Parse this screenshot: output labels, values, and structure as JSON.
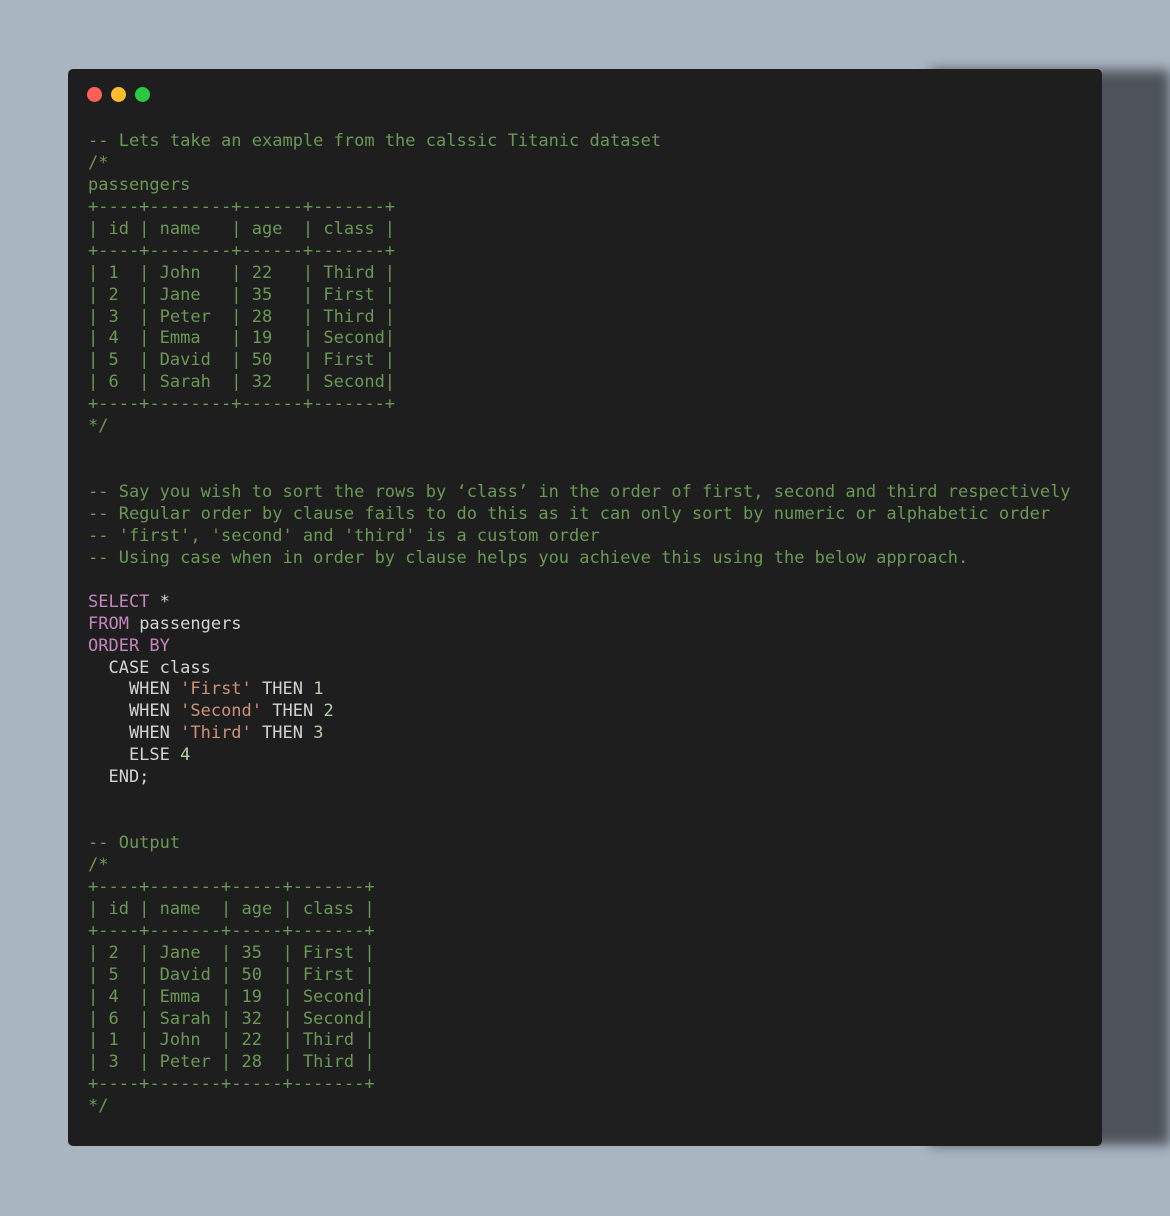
{
  "window": {
    "controls": {
      "close_color": "#ff5f57",
      "minimize_color": "#febc2e",
      "maximize_color": "#28c840"
    }
  },
  "code_lines": [
    [
      {
        "t": "comment",
        "s": "-- Lets take an example from the calssic Titanic dataset"
      }
    ],
    [
      {
        "t": "comment",
        "s": "/*"
      }
    ],
    [
      {
        "t": "comment",
        "s": "passengers"
      }
    ],
    [
      {
        "t": "comment",
        "s": "+----+--------+------+-------+"
      }
    ],
    [
      {
        "t": "comment",
        "s": "| id | name   | age  | class |"
      }
    ],
    [
      {
        "t": "comment",
        "s": "+----+--------+------+-------+"
      }
    ],
    [
      {
        "t": "comment",
        "s": "| 1  | John   | 22   | Third |"
      }
    ],
    [
      {
        "t": "comment",
        "s": "| 2  | Jane   | 35   | First |"
      }
    ],
    [
      {
        "t": "comment",
        "s": "| 3  | Peter  | 28   | Third |"
      }
    ],
    [
      {
        "t": "comment",
        "s": "| 4  | Emma   | 19   | Second|"
      }
    ],
    [
      {
        "t": "comment",
        "s": "| 5  | David  | 50   | First |"
      }
    ],
    [
      {
        "t": "comment",
        "s": "| 6  | Sarah  | 32   | Second|"
      }
    ],
    [
      {
        "t": "comment",
        "s": "+----+--------+------+-------+"
      }
    ],
    [
      {
        "t": "comment",
        "s": "*/"
      }
    ],
    [],
    [],
    [
      {
        "t": "comment",
        "s": "-- Say you wish to sort the rows by ‘class’ in the order of first, second and third respectively"
      }
    ],
    [
      {
        "t": "comment",
        "s": "-- Regular order by clause fails to do this as it can only sort by numeric or alphabetic order"
      }
    ],
    [
      {
        "t": "comment",
        "s": "-- 'first', 'second' and 'third' is a custom order"
      }
    ],
    [
      {
        "t": "comment",
        "s": "-- Using case when in order by clause helps you achieve this using the below approach."
      }
    ],
    [],
    [
      {
        "t": "keyword",
        "s": "SELECT"
      },
      {
        "t": "plain",
        "s": " *"
      }
    ],
    [
      {
        "t": "keyword",
        "s": "FROM"
      },
      {
        "t": "plain",
        "s": " passengers"
      }
    ],
    [
      {
        "t": "keyword",
        "s": "ORDER BY"
      }
    ],
    [
      {
        "t": "plain",
        "s": "  CASE class"
      }
    ],
    [
      {
        "t": "plain",
        "s": "    WHEN "
      },
      {
        "t": "string",
        "s": "'First'"
      },
      {
        "t": "plain",
        "s": " THEN "
      },
      {
        "t": "number",
        "s": "1"
      }
    ],
    [
      {
        "t": "plain",
        "s": "    WHEN "
      },
      {
        "t": "string",
        "s": "'Second'"
      },
      {
        "t": "plain",
        "s": " THEN "
      },
      {
        "t": "number",
        "s": "2"
      }
    ],
    [
      {
        "t": "plain",
        "s": "    WHEN "
      },
      {
        "t": "string",
        "s": "'Third'"
      },
      {
        "t": "plain",
        "s": " THEN "
      },
      {
        "t": "number",
        "s": "3"
      }
    ],
    [
      {
        "t": "plain",
        "s": "    ELSE "
      },
      {
        "t": "number",
        "s": "4"
      }
    ],
    [
      {
        "t": "plain",
        "s": "  END;"
      }
    ],
    [],
    [],
    [
      {
        "t": "comment",
        "s": "-- Output"
      }
    ],
    [
      {
        "t": "comment",
        "s": "/*"
      }
    ],
    [
      {
        "t": "comment",
        "s": "+----+-------+-----+-------+"
      }
    ],
    [
      {
        "t": "comment",
        "s": "| id | name  | age | class |"
      }
    ],
    [
      {
        "t": "comment",
        "s": "+----+-------+-----+-------+"
      }
    ],
    [
      {
        "t": "comment",
        "s": "| 2  | Jane  | 35  | First |"
      }
    ],
    [
      {
        "t": "comment",
        "s": "| 5  | David | 50  | First |"
      }
    ],
    [
      {
        "t": "comment",
        "s": "| 4  | Emma  | 19  | Second|"
      }
    ],
    [
      {
        "t": "comment",
        "s": "| 6  | Sarah | 32  | Second|"
      }
    ],
    [
      {
        "t": "comment",
        "s": "| 1  | John  | 22  | Third |"
      }
    ],
    [
      {
        "t": "comment",
        "s": "| 3  | Peter | 28  | Third |"
      }
    ],
    [
      {
        "t": "comment",
        "s": "+----+-------+-----+-------+"
      }
    ],
    [
      {
        "t": "comment",
        "s": "*/"
      }
    ]
  ]
}
